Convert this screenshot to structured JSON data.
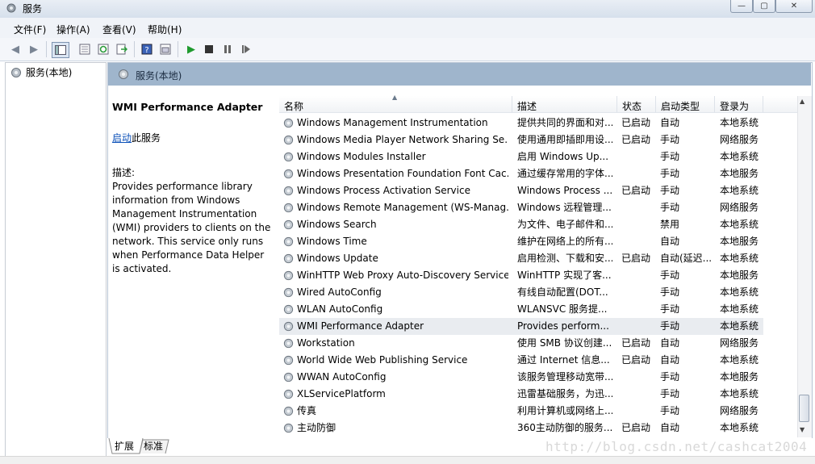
{
  "window": {
    "title": "服务",
    "controls": [
      "—",
      "▢",
      "✕"
    ]
  },
  "menu": [
    "文件(F)",
    "操作(A)",
    "查看(V)",
    "帮助(H)"
  ],
  "toolbar": [
    "back-icon",
    "forward-icon",
    "console-tree-icon",
    "properties-icon",
    "refresh-icon",
    "export-icon",
    "help-icon",
    "view-icon",
    "start-icon",
    "stop-icon",
    "pause-icon",
    "restart-icon"
  ],
  "tree": {
    "root_label": "服务(本地)"
  },
  "pane": {
    "title": "服务(本地)"
  },
  "detail": {
    "service_name": "WMI Performance Adapter",
    "start_link": "启动",
    "start_suffix": "此服务",
    "desc_label": "描述:",
    "desc_text": "Provides performance library information from Windows Management Instrumentation (WMI) providers to clients on the network. This service only runs when Performance Data Helper is activated."
  },
  "columns": [
    "名称",
    "描述",
    "状态",
    "启动类型",
    "登录为"
  ],
  "services": [
    [
      "Windows Management Instrumentation",
      "提供共同的界面和对...",
      "已启动",
      "自动",
      "本地系统"
    ],
    [
      "Windows Media Player Network Sharing Se...",
      "使用通用即插即用设...",
      "已启动",
      "手动",
      "网络服务"
    ],
    [
      "Windows Modules Installer",
      "启用 Windows Up...",
      "",
      "手动",
      "本地系统"
    ],
    [
      "Windows Presentation Foundation Font Cac...",
      "通过缓存常用的字体...",
      "",
      "手动",
      "本地服务"
    ],
    [
      "Windows Process Activation Service",
      "Windows Process ...",
      "已启动",
      "手动",
      "本地系统"
    ],
    [
      "Windows Remote Management (WS-Manag...",
      "Windows 远程管理...",
      "",
      "手动",
      "网络服务"
    ],
    [
      "Windows Search",
      "为文件、电子邮件和...",
      "",
      "禁用",
      "本地系统"
    ],
    [
      "Windows Time",
      "维护在网络上的所有...",
      "",
      "自动",
      "本地服务"
    ],
    [
      "Windows Update",
      "启用检测、下载和安...",
      "已启动",
      "自动(延迟...",
      "本地系统"
    ],
    [
      "WinHTTP Web Proxy Auto-Discovery Service",
      "WinHTTP 实现了客...",
      "",
      "手动",
      "本地服务"
    ],
    [
      "Wired AutoConfig",
      "有线自动配置(DOT...",
      "",
      "手动",
      "本地系统"
    ],
    [
      "WLAN AutoConfig",
      "WLANSVC 服务提...",
      "",
      "手动",
      "本地系统"
    ],
    [
      "WMI Performance Adapter",
      "Provides perform...",
      "",
      "手动",
      "本地系统"
    ],
    [
      "Workstation",
      "使用 SMB 协议创建...",
      "已启动",
      "自动",
      "网络服务"
    ],
    [
      "World Wide Web Publishing Service",
      "通过 Internet 信息...",
      "已启动",
      "自动",
      "本地系统"
    ],
    [
      "WWAN AutoConfig",
      "该服务管理移动宽带...",
      "",
      "手动",
      "本地服务"
    ],
    [
      "XLServicePlatform",
      "迅雷基础服务，为迅...",
      "",
      "手动",
      "本地系统"
    ],
    [
      "传真",
      "利用计算机或网络上...",
      "",
      "手动",
      "网络服务"
    ],
    [
      "主动防御",
      "360主动防御的服务...",
      "已启动",
      "自动",
      "本地系统"
    ]
  ],
  "selected_row": 12,
  "tabs": [
    "扩展",
    "标准"
  ],
  "watermark": "http://blog.csdn.net/cashcat2004"
}
